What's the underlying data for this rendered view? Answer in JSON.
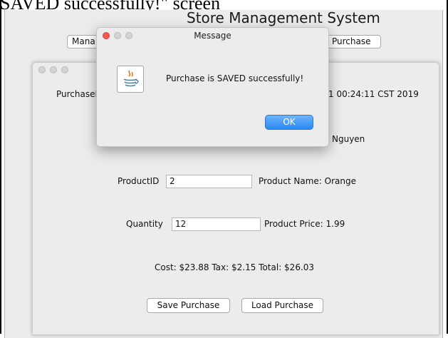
{
  "caption": "SAVED successfully!\" screen",
  "app": {
    "title": "Store Management System",
    "top_buttons": [
      "Mana",
      "Purchase"
    ]
  },
  "purchase_form": {
    "purchase_label": "PurchaseI",
    "date_text": "1 00:24:11 CST 2019",
    "customer_name_fragment": "Nguyen",
    "product_id_label": "ProductID",
    "product_id_value": "2",
    "product_name": "Product Name: Orange",
    "quantity_label": "Quantity",
    "quantity_value": "12",
    "product_price": "Product Price: 1.99",
    "totals": "Cost: $23.88 Tax: $2.15 Total: $26.03",
    "save_button": "Save Purchase",
    "load_button": "Load Purchase"
  },
  "dialog": {
    "title": "Message",
    "message": "Purchase is SAVED successfully!",
    "ok": "OK",
    "icon": "java-icon"
  },
  "colors": {
    "ok_button": "#2a8af6",
    "close_dot": "#f25a51"
  }
}
